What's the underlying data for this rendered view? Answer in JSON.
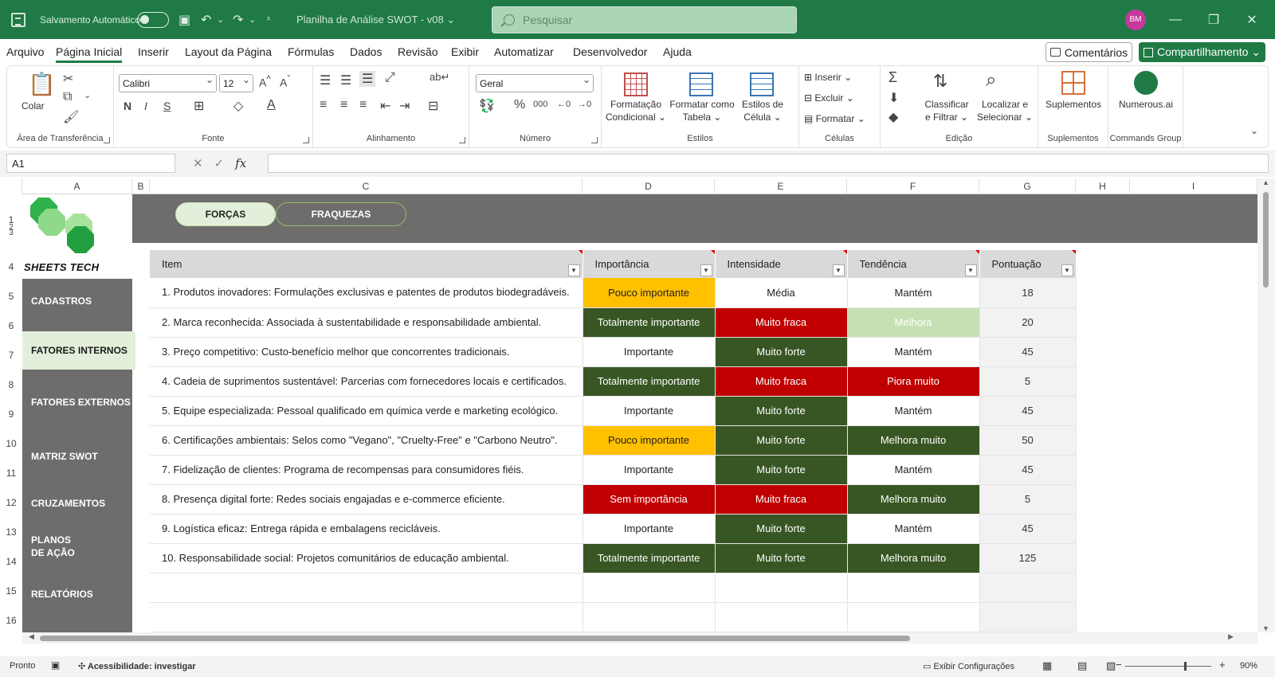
{
  "titlebar": {
    "autosave_label": "Salvamento Automático",
    "doc_title": "Planilha de Análise SWOT - v08 ⌄",
    "search_placeholder": "Pesquisar",
    "avatar_initials": "BM"
  },
  "menu": {
    "items": [
      "Arquivo",
      "Página Inicial",
      "Inserir",
      "Layout da Página",
      "Fórmulas",
      "Dados",
      "Revisão",
      "Exibir",
      "Automatizar",
      "Desenvolvedor",
      "Ajuda"
    ],
    "active": "Página Inicial",
    "comments_label": "Comentários",
    "share_label": "Compartilhamento ⌄"
  },
  "ribbon": {
    "clipboard": {
      "paste_label": "Colar",
      "group_label": "Área de Transferência"
    },
    "font": {
      "font_name": "Calibri",
      "font_size": "12",
      "group_label": "Fonte"
    },
    "alignment": {
      "group_label": "Alinhamento"
    },
    "number": {
      "format": "Geral",
      "group_label": "Número"
    },
    "styles": {
      "conditional_label": "Formatação Condicional ⌄",
      "table_label": "Formatar como Tabela ⌄",
      "cell_styles_label": "Estilos de Célula ⌄",
      "group_label": "Estilos"
    },
    "cells": {
      "insert_label": "Inserir",
      "delete_label": "Excluir",
      "format_label": "Formatar",
      "group_label": "Células"
    },
    "editing": {
      "sort_label": "Classificar e Filtrar ⌄",
      "find_label": "Localizar e Selecionar ⌄",
      "group_label": "Edição"
    },
    "addins": {
      "label": "Suplementos",
      "group_label": "Suplementos"
    },
    "commands": {
      "label": "Numerous.ai",
      "group_label": "Commands Group"
    }
  },
  "formula_bar": {
    "name_box": "A1",
    "fx": "fx",
    "formula": ""
  },
  "columns": [
    "A",
    "B",
    "C",
    "D",
    "E",
    "F",
    "G",
    "H",
    "I"
  ],
  "rows": [
    "1",
    "3",
    "2",
    "4",
    "5",
    "6",
    "7",
    "8",
    "9",
    "10",
    "11",
    "12",
    "13",
    "14",
    "15",
    "16"
  ],
  "logo": {
    "text": "SHEETS TECH"
  },
  "nav": [
    "CADASTROS",
    "FATORES INTERNOS",
    "FATORES EXTERNOS",
    "MATRIZ SWOT",
    "CRUZAMENTOS",
    "PLANOS DE AÇÃO",
    "RELATÓRIOS"
  ],
  "nav_active": "FATORES INTERNOS",
  "tabs": {
    "forcas": "FORÇAS",
    "fraquezas": "FRAQUEZAS"
  },
  "table": {
    "headers": [
      "Item",
      "Importância",
      "Intensidade",
      "Tendência",
      "Pontuação"
    ],
    "rows": [
      {
        "item": "1. Produtos inovadores: Formulações exclusivas e patentes de produtos biodegradáveis.",
        "importancia": "Pouco importante",
        "intensidade": "Média",
        "tendencia": "Mantém",
        "pontuacao": "18"
      },
      {
        "item": "2. Marca reconhecida: Associada à sustentabilidade e responsabilidade ambiental.",
        "importancia": "Totalmente importante",
        "intensidade": "Muito fraca",
        "tendencia": "Melhora",
        "pontuacao": "20"
      },
      {
        "item": "3. Preço competitivo: Custo-benefício melhor que concorrentes tradicionais.",
        "importancia": "Importante",
        "intensidade": "Muito forte",
        "tendencia": "Mantém",
        "pontuacao": "45"
      },
      {
        "item": "4. Cadeia de suprimentos sustentável: Parcerias com fornecedores locais e certificados.",
        "importancia": "Totalmente importante",
        "intensidade": "Muito fraca",
        "tendencia": "Piora muito",
        "pontuacao": "5"
      },
      {
        "item": "5. Equipe especializada: Pessoal qualificado em química verde e marketing ecológico.",
        "importancia": "Importante",
        "intensidade": "Muito forte",
        "tendencia": "Mantém",
        "pontuacao": "45"
      },
      {
        "item": "6. Certificações ambientais: Selos como \"Vegano\", \"Cruelty-Free\" e \"Carbono Neutro\".",
        "importancia": "Pouco importante",
        "intensidade": "Muito forte",
        "tendencia": "Melhora muito",
        "pontuacao": "50"
      },
      {
        "item": "7. Fidelização de clientes: Programa de recompensas para consumidores fiéis.",
        "importancia": "Importante",
        "intensidade": "Muito forte",
        "tendencia": "Mantém",
        "pontuacao": "45"
      },
      {
        "item": "8. Presença digital forte: Redes sociais engajadas e e-commerce eficiente.",
        "importancia": "Sem importância",
        "intensidade": "Muito fraca",
        "tendencia": "Melhora muito",
        "pontuacao": "5"
      },
      {
        "item": "9. Logística eficaz: Entrega rápida e embalagens recicláveis.",
        "importancia": "Importante",
        "intensidade": "Muito forte",
        "tendencia": "Mantém",
        "pontuacao": "45"
      },
      {
        "item": "10. Responsabilidade social: Projetos comunitários de educação ambiental.",
        "importancia": "Totalmente importante",
        "intensidade": "Muito forte",
        "tendencia": "Melhora muito",
        "pontuacao": "125"
      }
    ]
  },
  "value_colors": {
    "Pouco importante": "#ffc000",
    "Totalmente importante": "#375623",
    "Sem importância": "#c00000",
    "Muito fraca": "#c00000",
    "Muito forte": "#375623",
    "Melhora": "#c6e0b4",
    "Piora muito": "#c00000",
    "Melhora muito": "#375623"
  },
  "statusbar": {
    "ready": "Pronto",
    "accessibility": "Acessibilidade: investigar",
    "display_settings": "Exibir Configurações",
    "zoom": "90%"
  }
}
